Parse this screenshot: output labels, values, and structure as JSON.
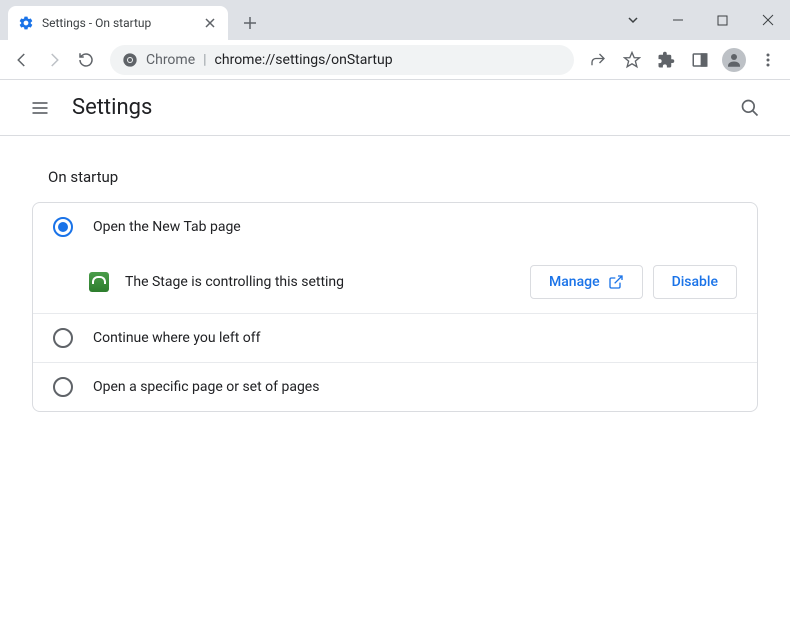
{
  "browser": {
    "tab_title": "Settings - On startup",
    "url_origin": "Chrome",
    "url_path": "chrome://settings/onStartup"
  },
  "header": {
    "title": "Settings"
  },
  "section": {
    "title": "On startup"
  },
  "options": {
    "new_tab": {
      "label": "Open the New Tab page"
    },
    "controlled": {
      "label": "The Stage is controlling this setting",
      "manage": "Manage",
      "disable": "Disable"
    },
    "continue": {
      "label": "Continue where you left off"
    },
    "specific": {
      "label": "Open a specific page or set of pages"
    }
  }
}
